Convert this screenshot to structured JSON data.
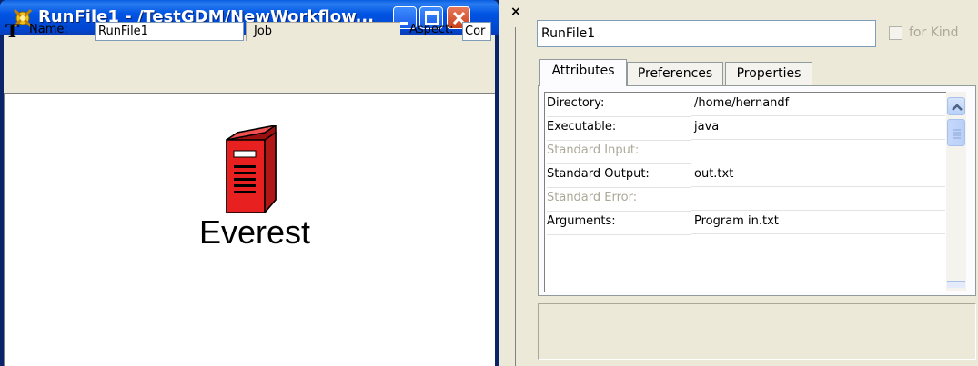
{
  "window": {
    "title": "RunFile1 - /TestGDM/NewWorkflow...",
    "colors": {
      "titlebar": "#0054e3",
      "close": "#c8401c"
    }
  },
  "toolbar": {
    "name_label": "Name:",
    "name_value": "RunFile1",
    "kind_value": "Job",
    "aspect_label": "Aspect:",
    "aspect_value": "Cor"
  },
  "canvas": {
    "model_label": "Everest",
    "model_icon": "server-tower-icon",
    "model_color": "#e02020"
  },
  "panel": {
    "object_name": "RunFile1",
    "for_kind_label": "for Kind",
    "tabs": [
      {
        "label": "Attributes"
      },
      {
        "label": "Preferences"
      },
      {
        "label": "Properties"
      }
    ],
    "attributes": [
      {
        "key": "Directory:",
        "value": "/home/hernandf"
      },
      {
        "key": "Executable:",
        "value": "java"
      },
      {
        "key": "Standard Input:",
        "value": ""
      },
      {
        "key": "Standard Output:",
        "value": "out.txt"
      },
      {
        "key": "Standard Error:",
        "value": ""
      },
      {
        "key": "Arguments:",
        "value": "Program in.txt"
      }
    ]
  }
}
